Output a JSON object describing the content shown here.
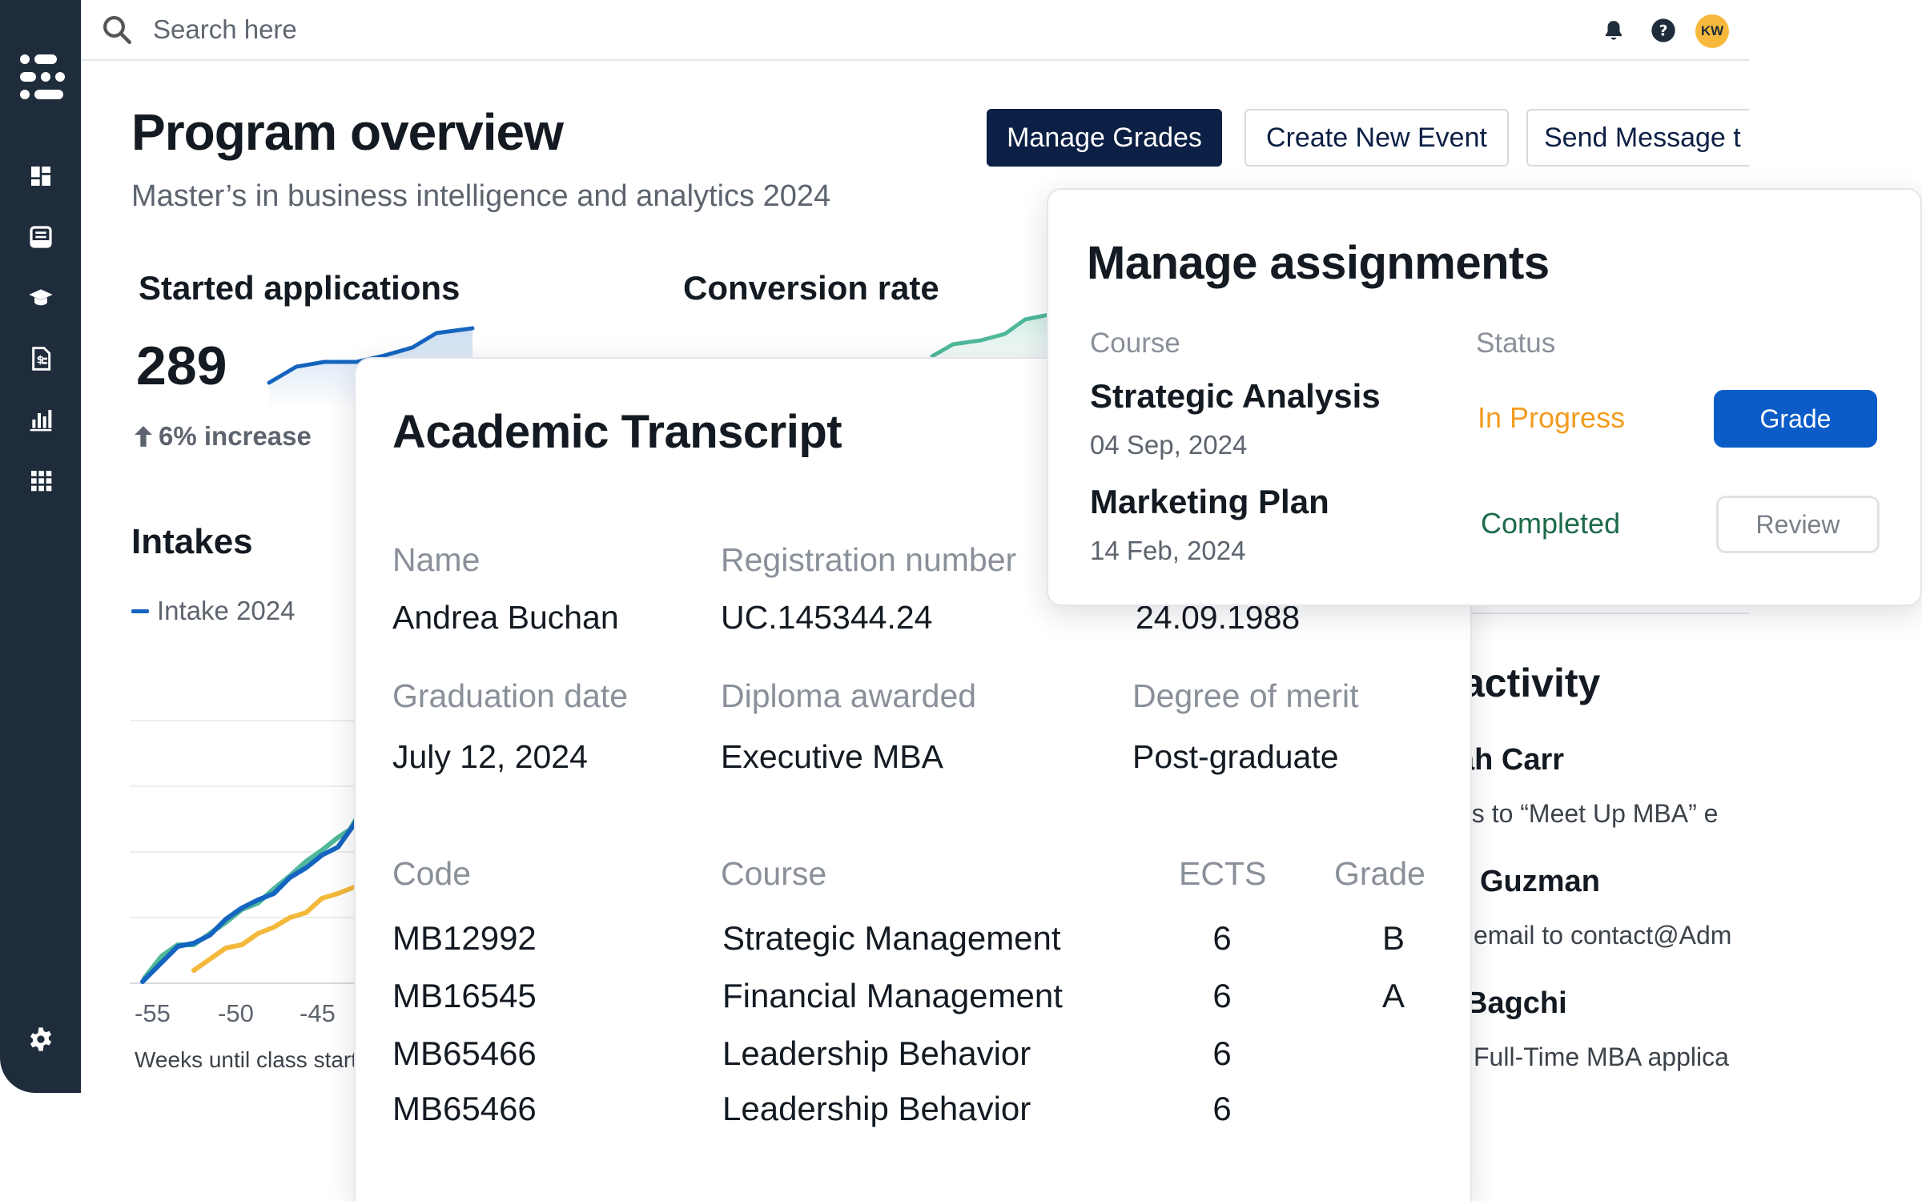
{
  "search": {
    "placeholder": "Search here"
  },
  "user": {
    "initials": "KW"
  },
  "page": {
    "title": "Program overview",
    "subtitle": "Master’s in business intelligence and analytics 2024"
  },
  "actions": {
    "manage_grades": "Manage Grades",
    "create_event": "Create New Event",
    "send_message": "Send Message t"
  },
  "metrics": {
    "started": {
      "label": "Started applications",
      "value": "289",
      "delta": "6% increase"
    },
    "conversion": {
      "label": "Conversion rate"
    }
  },
  "intakes": {
    "title": "Intakes",
    "legend": "Intake 2024",
    "ticks": [
      "-55",
      "-50",
      "-45"
    ],
    "xlabel": "Weeks until class start"
  },
  "activity": {
    "title": "activity",
    "items": [
      {
        "name": "ah Carr",
        "desc": "es to “Meet Up MBA” e"
      },
      {
        "name": "Guzman",
        "desc": "email to contact@Adm"
      },
      {
        "name": "Bagchi",
        "desc": "Full-Time MBA applica"
      }
    ]
  },
  "transcript": {
    "title": "Academic Transcript",
    "fields": {
      "name_label": "Name",
      "name": "Andrea Buchan",
      "reg_label": "Registration number",
      "reg": "UC.145344.24",
      "dob": "24.09.1988",
      "grad_label": "Graduation date",
      "grad": "July 12, 2024",
      "diploma_label": "Diploma awarded",
      "diploma": "Executive MBA",
      "merit_label": "Degree of merit",
      "merit": "Post-graduate"
    },
    "columns": {
      "code": "Code",
      "course": "Course",
      "ects": "ECTS",
      "grade": "Grade"
    },
    "rows": [
      {
        "code": "MB12992",
        "course": "Strategic Management",
        "ects": "6",
        "grade": "B"
      },
      {
        "code": "MB16545",
        "course": "Financial Management",
        "ects": "6",
        "grade": "A"
      },
      {
        "code": "MB65466",
        "course": "Leadership Behavior",
        "ects": "6",
        "grade": ""
      },
      {
        "code": "MB65466",
        "course": "Leadership Behavior",
        "ects": "6",
        "grade": ""
      }
    ]
  },
  "assignments": {
    "title": "Manage assignments",
    "col_course": "Course",
    "col_status": "Status",
    "items": [
      {
        "course": "Strategic Analysis",
        "date": "04 Sep, 2024",
        "status": "In Progress",
        "action": "Grade"
      },
      {
        "course": "Marketing Plan",
        "date": "14 Feb, 2024",
        "status": "Completed",
        "action": "Review"
      }
    ]
  },
  "colors": {
    "sidebar": "#1f2c3b",
    "primary": "#0c1f44",
    "accent": "#0b5cc7",
    "in_progress": "#f29c1f",
    "completed": "#1e6b4a",
    "series_blue": "#1565c0",
    "series_teal": "#4fb89a",
    "series_yellow": "#f4b93b"
  },
  "icons": [
    "logo-icon",
    "dashboard-icon",
    "inbox-icon",
    "graduation-cap-icon",
    "billing-icon",
    "chart-icon",
    "grid-icon",
    "settings-icon",
    "search-icon",
    "bell-icon",
    "help-icon"
  ]
}
